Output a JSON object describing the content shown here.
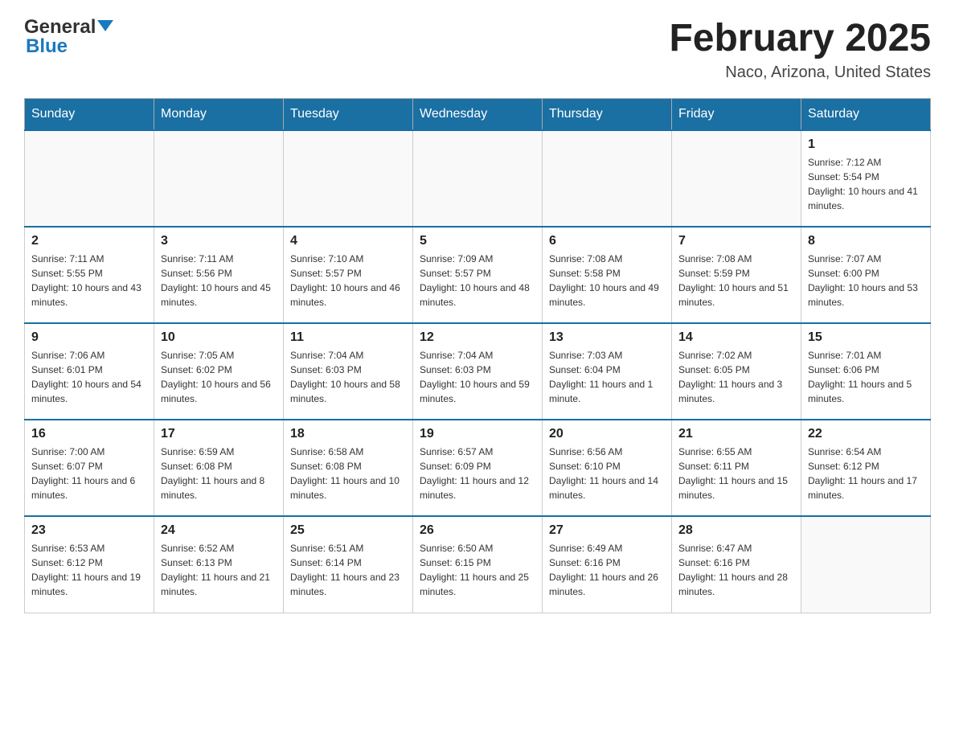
{
  "header": {
    "logo_general": "General",
    "logo_blue": "Blue",
    "month_title": "February 2025",
    "location": "Naco, Arizona, United States"
  },
  "days_of_week": [
    "Sunday",
    "Monday",
    "Tuesday",
    "Wednesday",
    "Thursday",
    "Friday",
    "Saturday"
  ],
  "weeks": [
    {
      "days": [
        {
          "number": "",
          "info": ""
        },
        {
          "number": "",
          "info": ""
        },
        {
          "number": "",
          "info": ""
        },
        {
          "number": "",
          "info": ""
        },
        {
          "number": "",
          "info": ""
        },
        {
          "number": "",
          "info": ""
        },
        {
          "number": "1",
          "info": "Sunrise: 7:12 AM\nSunset: 5:54 PM\nDaylight: 10 hours and 41 minutes."
        }
      ]
    },
    {
      "days": [
        {
          "number": "2",
          "info": "Sunrise: 7:11 AM\nSunset: 5:55 PM\nDaylight: 10 hours and 43 minutes."
        },
        {
          "number": "3",
          "info": "Sunrise: 7:11 AM\nSunset: 5:56 PM\nDaylight: 10 hours and 45 minutes."
        },
        {
          "number": "4",
          "info": "Sunrise: 7:10 AM\nSunset: 5:57 PM\nDaylight: 10 hours and 46 minutes."
        },
        {
          "number": "5",
          "info": "Sunrise: 7:09 AM\nSunset: 5:57 PM\nDaylight: 10 hours and 48 minutes."
        },
        {
          "number": "6",
          "info": "Sunrise: 7:08 AM\nSunset: 5:58 PM\nDaylight: 10 hours and 49 minutes."
        },
        {
          "number": "7",
          "info": "Sunrise: 7:08 AM\nSunset: 5:59 PM\nDaylight: 10 hours and 51 minutes."
        },
        {
          "number": "8",
          "info": "Sunrise: 7:07 AM\nSunset: 6:00 PM\nDaylight: 10 hours and 53 minutes."
        }
      ]
    },
    {
      "days": [
        {
          "number": "9",
          "info": "Sunrise: 7:06 AM\nSunset: 6:01 PM\nDaylight: 10 hours and 54 minutes."
        },
        {
          "number": "10",
          "info": "Sunrise: 7:05 AM\nSunset: 6:02 PM\nDaylight: 10 hours and 56 minutes."
        },
        {
          "number": "11",
          "info": "Sunrise: 7:04 AM\nSunset: 6:03 PM\nDaylight: 10 hours and 58 minutes."
        },
        {
          "number": "12",
          "info": "Sunrise: 7:04 AM\nSunset: 6:03 PM\nDaylight: 10 hours and 59 minutes."
        },
        {
          "number": "13",
          "info": "Sunrise: 7:03 AM\nSunset: 6:04 PM\nDaylight: 11 hours and 1 minute."
        },
        {
          "number": "14",
          "info": "Sunrise: 7:02 AM\nSunset: 6:05 PM\nDaylight: 11 hours and 3 minutes."
        },
        {
          "number": "15",
          "info": "Sunrise: 7:01 AM\nSunset: 6:06 PM\nDaylight: 11 hours and 5 minutes."
        }
      ]
    },
    {
      "days": [
        {
          "number": "16",
          "info": "Sunrise: 7:00 AM\nSunset: 6:07 PM\nDaylight: 11 hours and 6 minutes."
        },
        {
          "number": "17",
          "info": "Sunrise: 6:59 AM\nSunset: 6:08 PM\nDaylight: 11 hours and 8 minutes."
        },
        {
          "number": "18",
          "info": "Sunrise: 6:58 AM\nSunset: 6:08 PM\nDaylight: 11 hours and 10 minutes."
        },
        {
          "number": "19",
          "info": "Sunrise: 6:57 AM\nSunset: 6:09 PM\nDaylight: 11 hours and 12 minutes."
        },
        {
          "number": "20",
          "info": "Sunrise: 6:56 AM\nSunset: 6:10 PM\nDaylight: 11 hours and 14 minutes."
        },
        {
          "number": "21",
          "info": "Sunrise: 6:55 AM\nSunset: 6:11 PM\nDaylight: 11 hours and 15 minutes."
        },
        {
          "number": "22",
          "info": "Sunrise: 6:54 AM\nSunset: 6:12 PM\nDaylight: 11 hours and 17 minutes."
        }
      ]
    },
    {
      "days": [
        {
          "number": "23",
          "info": "Sunrise: 6:53 AM\nSunset: 6:12 PM\nDaylight: 11 hours and 19 minutes."
        },
        {
          "number": "24",
          "info": "Sunrise: 6:52 AM\nSunset: 6:13 PM\nDaylight: 11 hours and 21 minutes."
        },
        {
          "number": "25",
          "info": "Sunrise: 6:51 AM\nSunset: 6:14 PM\nDaylight: 11 hours and 23 minutes."
        },
        {
          "number": "26",
          "info": "Sunrise: 6:50 AM\nSunset: 6:15 PM\nDaylight: 11 hours and 25 minutes."
        },
        {
          "number": "27",
          "info": "Sunrise: 6:49 AM\nSunset: 6:16 PM\nDaylight: 11 hours and 26 minutes."
        },
        {
          "number": "28",
          "info": "Sunrise: 6:47 AM\nSunset: 6:16 PM\nDaylight: 11 hours and 28 minutes."
        },
        {
          "number": "",
          "info": ""
        }
      ]
    }
  ]
}
